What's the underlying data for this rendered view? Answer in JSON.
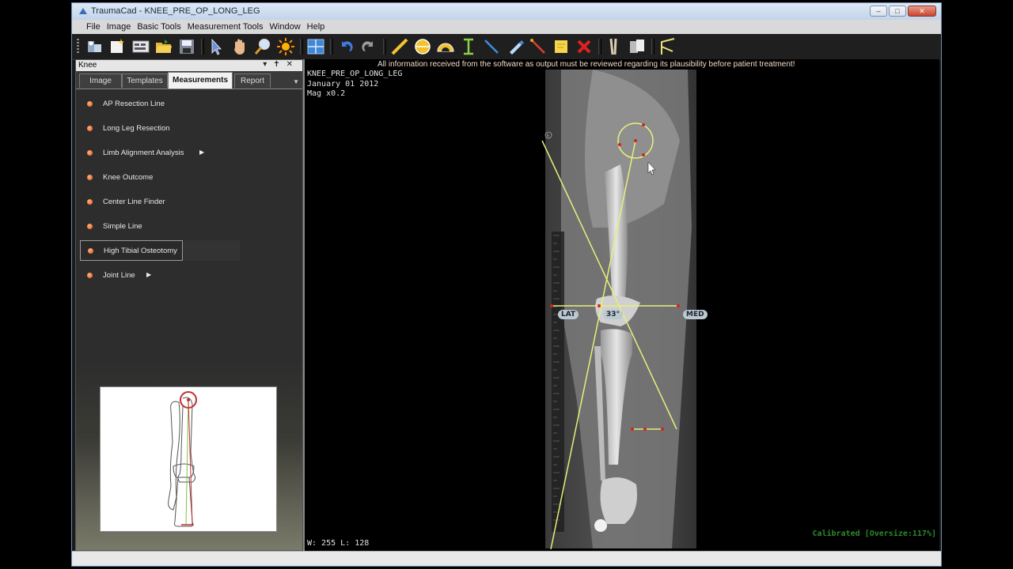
{
  "window": {
    "title": "TraumaCad - KNEE_PRE_OP_LONG_LEG",
    "controls": [
      "–",
      "□",
      "✕"
    ]
  },
  "menu": [
    "File",
    "Image",
    "Basic Tools",
    "Measurement Tools",
    "Window",
    "Help"
  ],
  "toolbar": {
    "icons": [
      "patient-icon",
      "new-case-icon",
      "image-browser-icon",
      "open-folder-icon",
      "save-icon",
      "pointer-icon",
      "pan-hand-icon",
      "zoom-icon",
      "brightness-icon",
      "layout-grid-icon",
      "undo-icon",
      "redo-icon",
      "line-tool-icon",
      "circle-tool-icon",
      "protractor-icon",
      "length-tool-icon",
      "blue-line-icon",
      "marker-icon",
      "red-line-icon",
      "note-icon",
      "delete-icon",
      "templates-icon",
      "cut-icon",
      "osteotomy-icon"
    ]
  },
  "panel": {
    "title": "Knee",
    "tabs": [
      "Image",
      "Templates",
      "Measurements",
      "Report"
    ],
    "active_tab": "Measurements",
    "items": [
      {
        "label": "AP Resection Line",
        "submenu": false
      },
      {
        "label": "Long Leg Resection",
        "submenu": false
      },
      {
        "label": "Limb Alignment Analysis",
        "submenu": true
      },
      {
        "label": "Knee Outcome",
        "submenu": false
      },
      {
        "label": "Center Line Finder",
        "submenu": false
      },
      {
        "label": "Simple Line",
        "submenu": false
      },
      {
        "label": "High Tibial Osteotomy",
        "submenu": false,
        "selected": true
      },
      {
        "label": "Joint Line",
        "submenu": true
      }
    ]
  },
  "viewer": {
    "warning": "All information received from the software as output must be reviewed regarding its plausibility before patient treatment!",
    "study_name": "KNEE_PRE_OP_LONG_LEG",
    "date": "January 01 2012",
    "magnification": "Mag x0.2",
    "window_level": "W: 255 L: 128",
    "calibration": "Calibrated [Oversize:117%]",
    "labels": {
      "lat": "LAT",
      "angle": "33°",
      "med": "MED"
    },
    "marker_r": "R"
  },
  "colors": {
    "measure_line": "#e8ef7a",
    "endpoint": "#d62020",
    "accent_orange": "#e0571a",
    "calibrated_text": "#2a8a2a"
  }
}
